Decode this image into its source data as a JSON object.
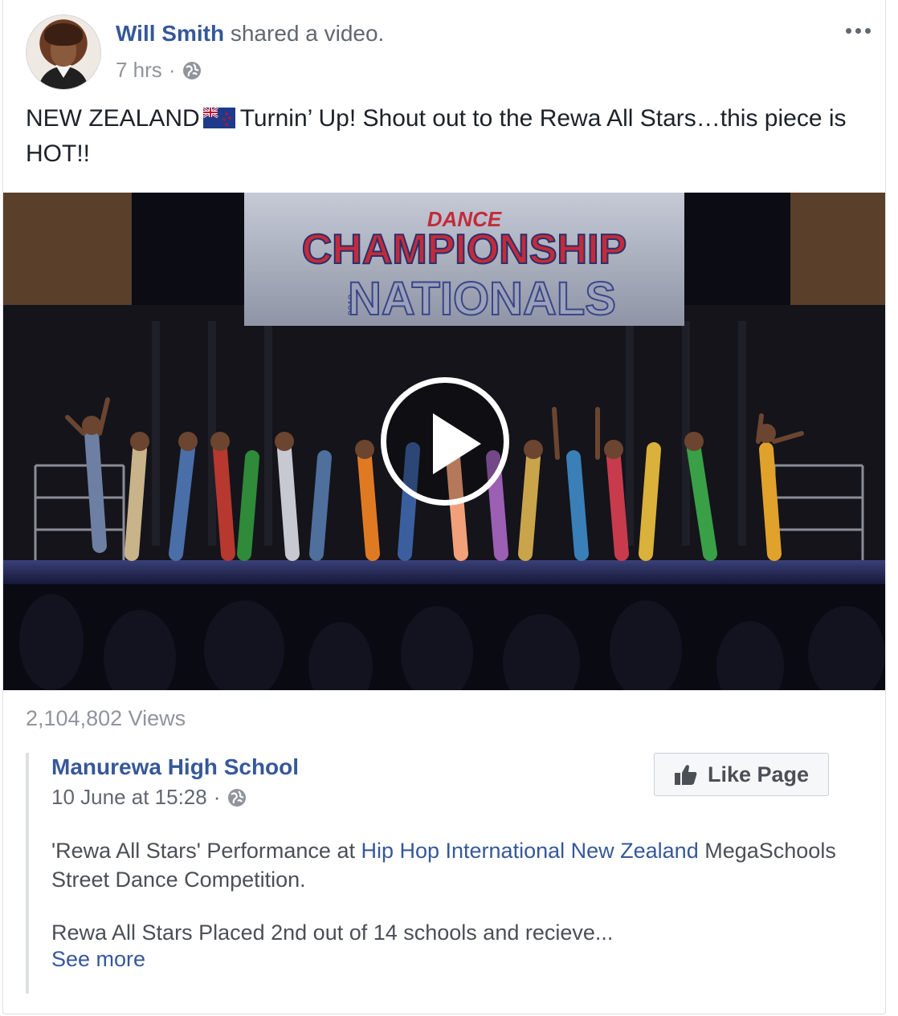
{
  "post": {
    "author": "Will Smith",
    "action": "shared a video.",
    "time": "7 hrs",
    "separator": "·",
    "caption_before_flag": "NEW ZEALAND",
    "caption_after_flag": "Turnin’ Up! Shout out to the Rewa All Stars…this piece is HOT!!",
    "more_icon": "more-horizontal-icon",
    "flag_icon": "new-zealand-flag-icon"
  },
  "video": {
    "banner_line1": "DANCE",
    "banner_line2": "CHAMPIONSHIP",
    "banner_line3": "NATIONALS",
    "banner_year": "2018",
    "play_icon": "play-icon",
    "views": "2,104,802 Views"
  },
  "shared": {
    "page_name": "Manurewa High School",
    "date": "10 June at 15:28",
    "separator": "·",
    "like_label": "Like Page",
    "desc_prefix": "'Rewa All Stars' Performance at ",
    "desc_link": "Hip Hop International New Zealand",
    "desc_suffix": " MegaSchools Street Dance Competition.",
    "desc2": "Rewa All Stars Placed 2nd out of 14 schools and recieve...",
    "see_more": "See more"
  },
  "colors": {
    "link": "#365899",
    "meta": "#90949c",
    "text": "#1d2129"
  }
}
